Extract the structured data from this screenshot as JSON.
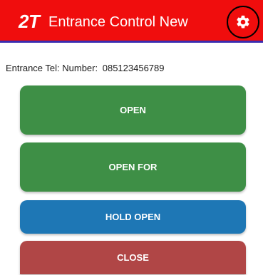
{
  "app": {
    "logo": "2T",
    "title": "Entrance Control New"
  },
  "icons": {
    "settings": "gear-icon"
  },
  "entrance": {
    "tel_label": "Entrance Tel: Number:",
    "tel_number": "085123456789"
  },
  "buttons": {
    "open": "OPEN",
    "open_for": "OPEN FOR",
    "hold_open": "HOLD OPEN",
    "close": "CLOSE"
  },
  "colors": {
    "appbar": "#f00d0d",
    "appbar_underline": "#3a2bb0",
    "open": "#3e8f46",
    "hold_open": "#1e77b5",
    "close": "#b04646"
  }
}
